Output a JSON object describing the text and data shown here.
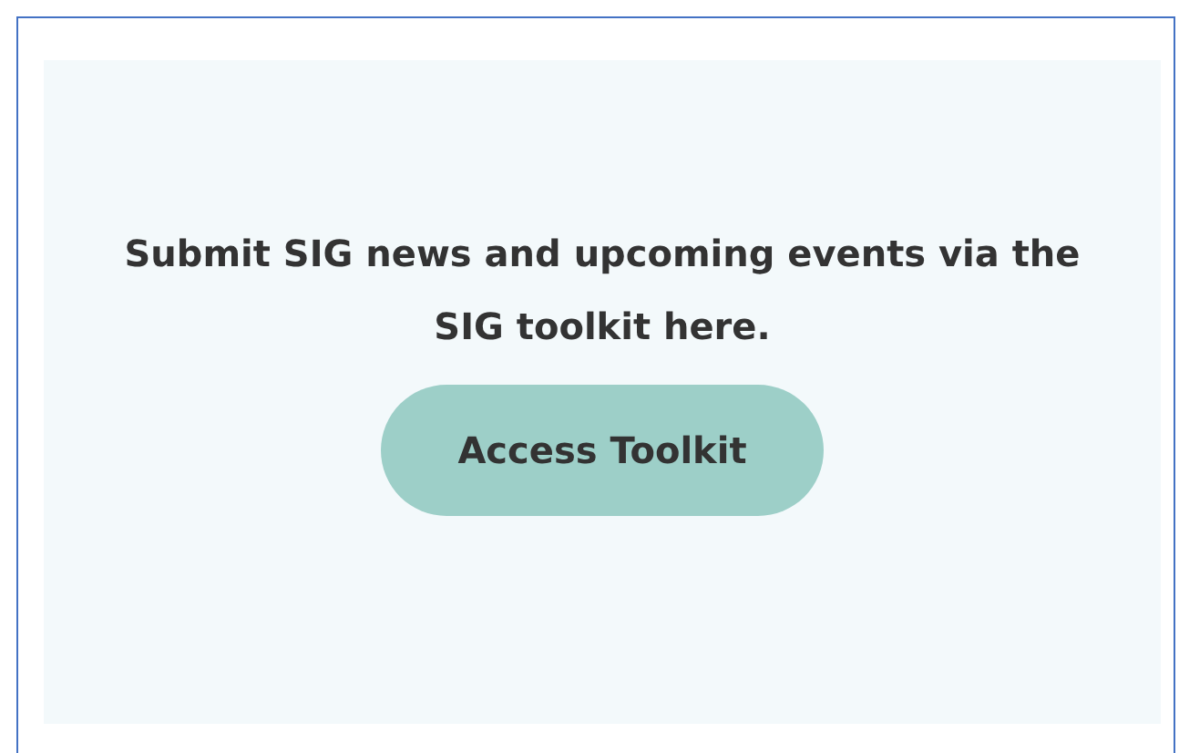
{
  "message": "Submit SIG news and upcoming events via the SIG toolkit here.",
  "button": {
    "label": "Access Toolkit"
  }
}
